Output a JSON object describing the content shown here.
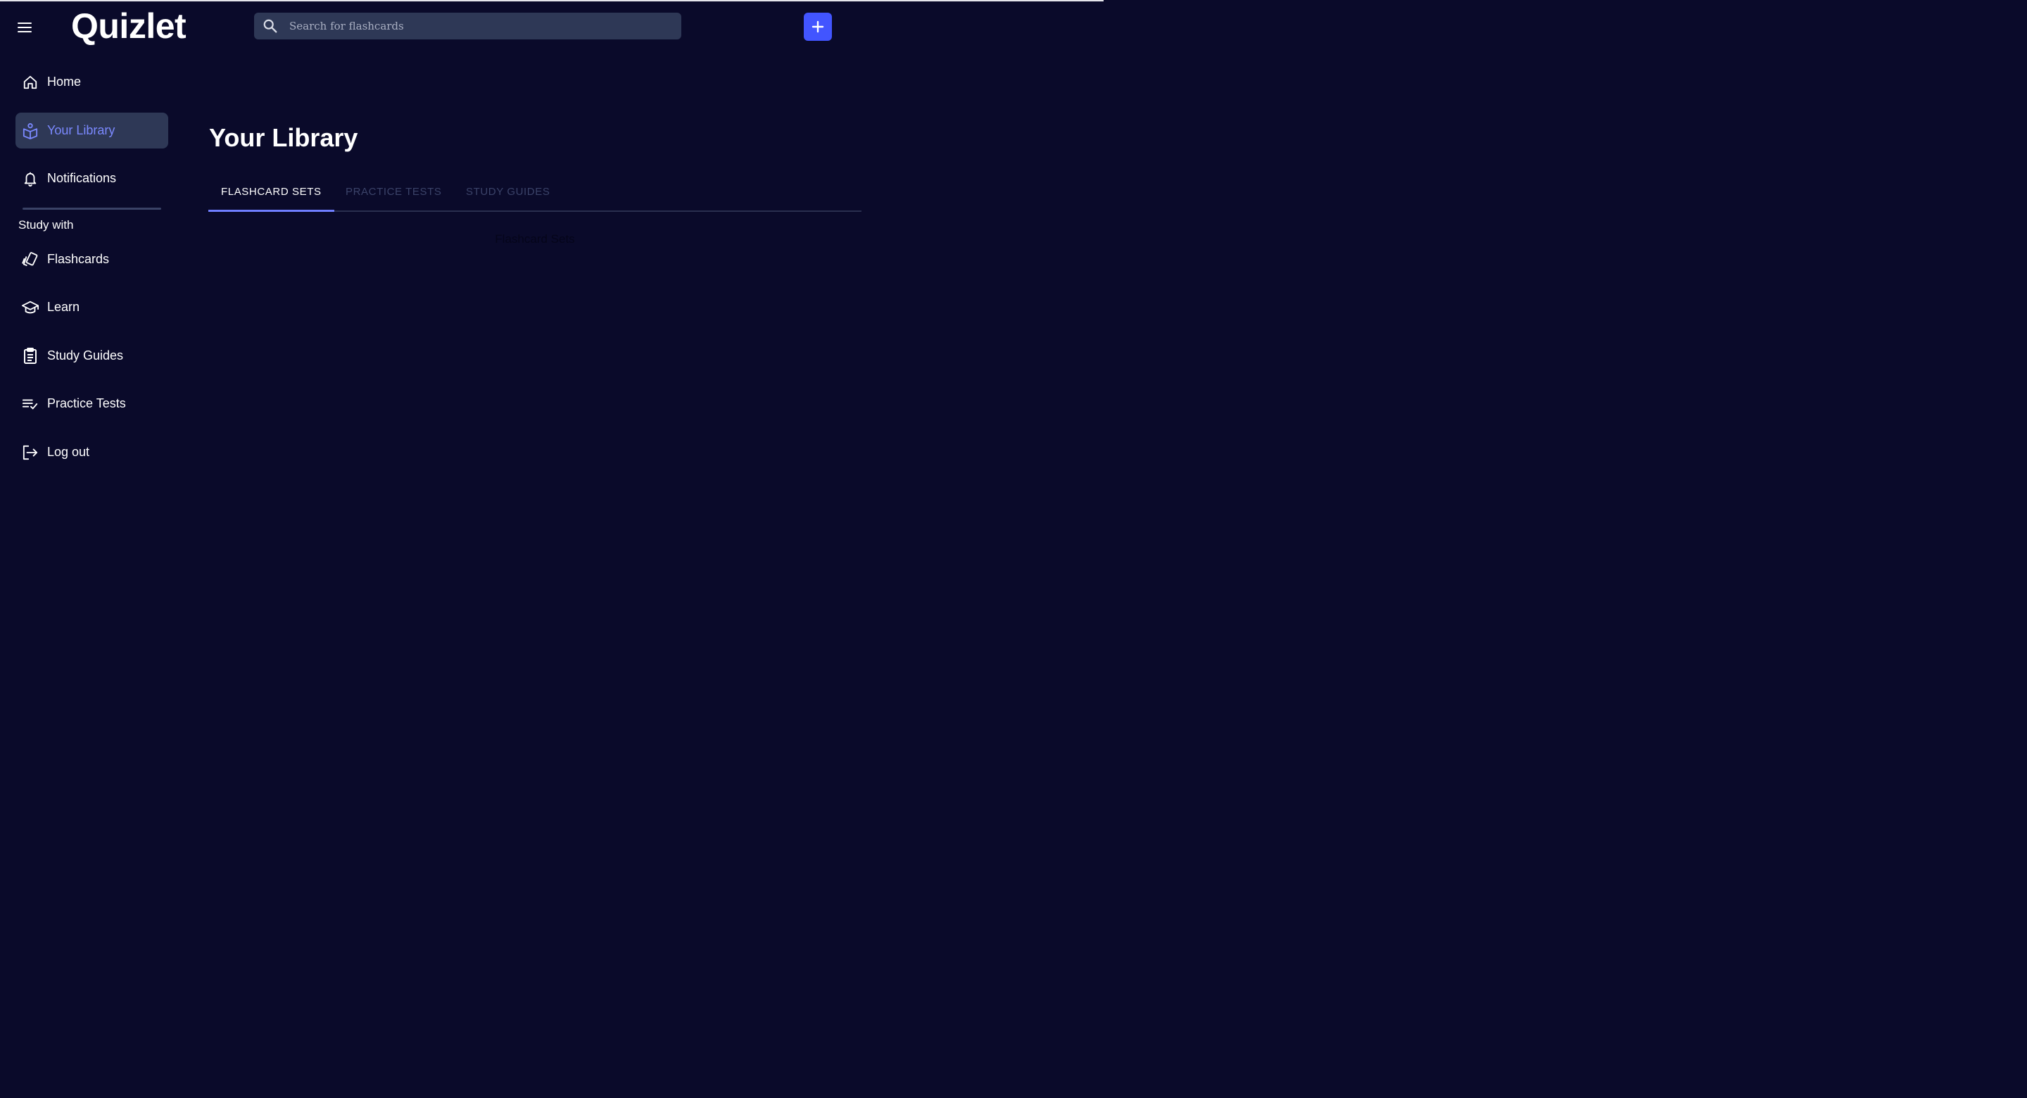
{
  "header": {
    "logo": "Quizlet",
    "search_placeholder": "Search for flashcards"
  },
  "sidebar": {
    "top_items": [
      {
        "label": "Home",
        "icon": "home-icon"
      },
      {
        "label": "Your Library",
        "icon": "library-icon",
        "active": true
      },
      {
        "label": "Notifications",
        "icon": "bell-icon"
      }
    ],
    "section_label": "Study with",
    "study_items": [
      {
        "label": "Flashcards",
        "icon": "flashcards-icon"
      },
      {
        "label": "Learn",
        "icon": "graduation-cap-icon"
      },
      {
        "label": "Study Guides",
        "icon": "clipboard-icon"
      },
      {
        "label": "Practice Tests",
        "icon": "checklist-icon"
      },
      {
        "label": "Log out",
        "icon": "logout-icon"
      }
    ]
  },
  "main": {
    "title": "Your Library",
    "tabs": [
      {
        "label": "FLASHCARD SETS",
        "active": true
      },
      {
        "label": "PRACTICE TESTS",
        "active": false
      },
      {
        "label": "STUDY GUIDES",
        "active": false
      }
    ],
    "panel_text": "Flashcard Sets"
  },
  "colors": {
    "background": "#0a0a2a",
    "surface": "#2e3856",
    "accent": "#4255ff",
    "active_text": "#7b89ff"
  }
}
